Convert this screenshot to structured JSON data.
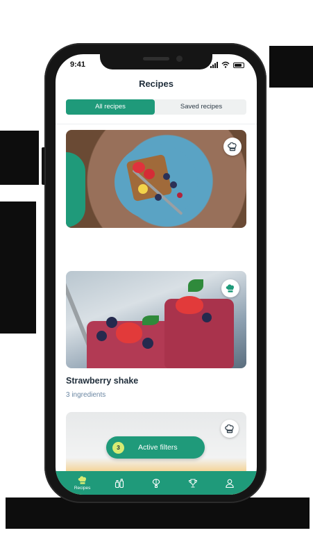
{
  "colors": {
    "accent": "#1f9a7a",
    "badge": "#d7eb73",
    "title_text": "#1f2d3a",
    "sub_text": "#6a86a2"
  },
  "status_bar": {
    "time": "9:41",
    "icons": [
      "signal-icon",
      "wifi-icon",
      "battery-icon"
    ]
  },
  "header": {
    "title": "Recipes"
  },
  "segmented_control": {
    "options": [
      {
        "label": "All recipes",
        "selected": true
      },
      {
        "label": "Saved recipes",
        "selected": false
      }
    ]
  },
  "recipes": [
    {
      "title": "",
      "subtitle": "",
      "icon": "chef-hat-icon",
      "saved": false
    },
    {
      "title": "Strawberry shake",
      "subtitle": "3 ingredients",
      "icon": "chef-hat-icon",
      "saved": true
    },
    {
      "title": "",
      "subtitle": "",
      "icon": "chef-hat-icon",
      "saved": false
    }
  ],
  "filters_button": {
    "count": "3",
    "label": "Active filters"
  },
  "bottom_nav": [
    {
      "icon": "chef-hat-icon",
      "label": "Recipes",
      "active": true
    },
    {
      "icon": "bottles-icon",
      "label": "",
      "active": false
    },
    {
      "icon": "balloon-icon",
      "label": "",
      "active": false
    },
    {
      "icon": "trophy-icon",
      "label": "",
      "active": false
    },
    {
      "icon": "profile-icon",
      "label": "",
      "active": false
    }
  ]
}
